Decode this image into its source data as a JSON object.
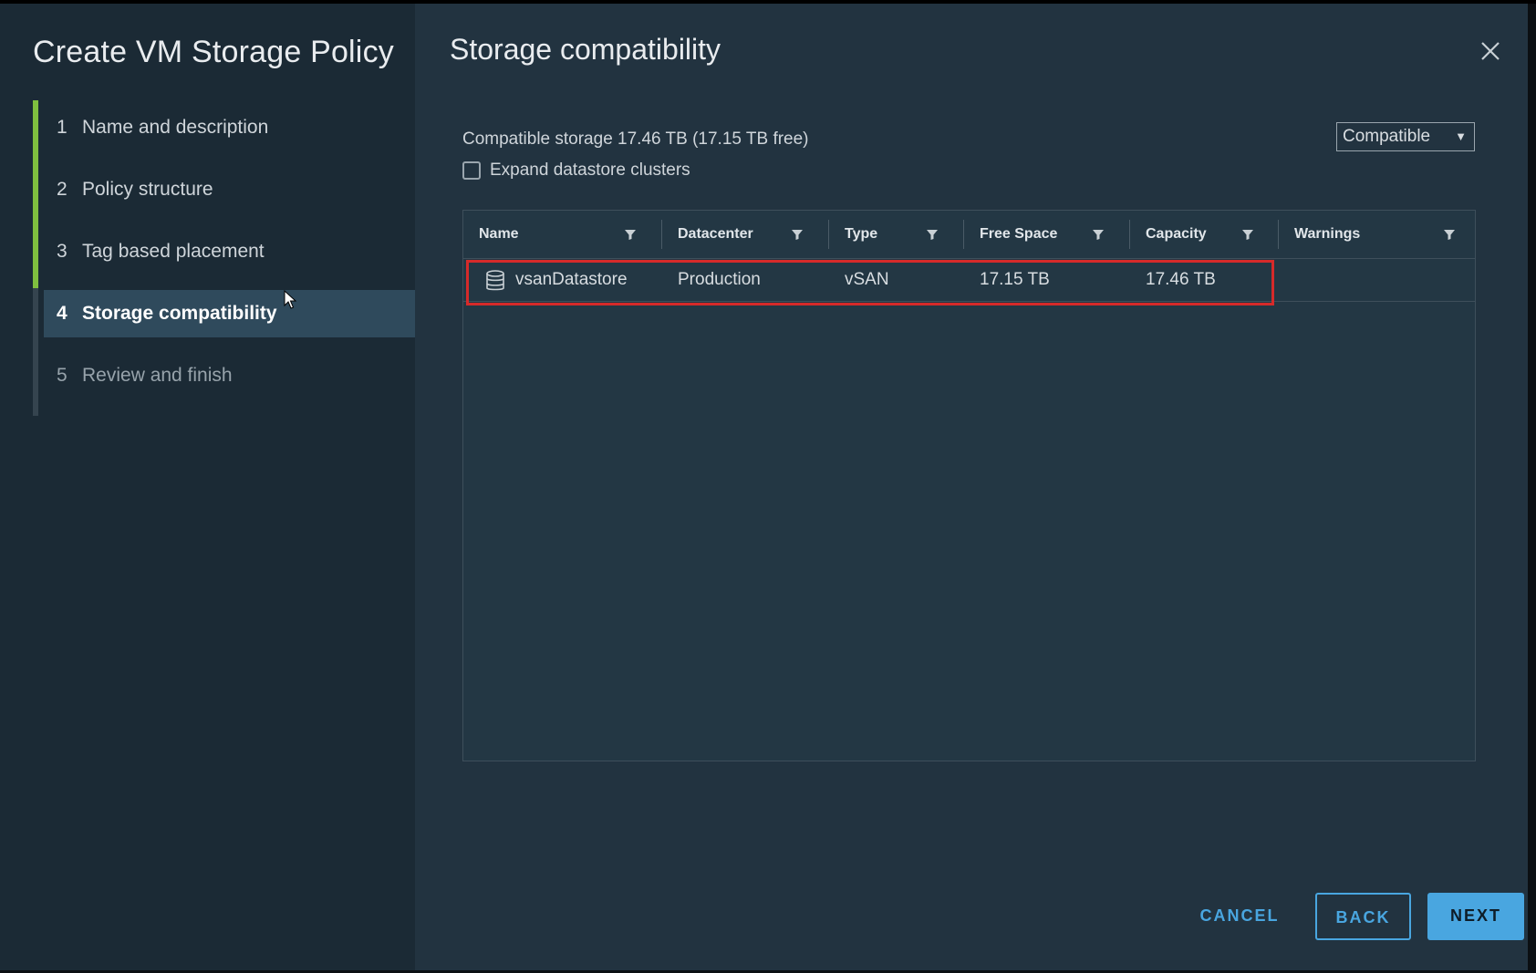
{
  "wizard": {
    "title": "Create VM Storage Policy",
    "steps": [
      {
        "num": "1",
        "label": "Name and description"
      },
      {
        "num": "2",
        "label": "Policy structure"
      },
      {
        "num": "3",
        "label": "Tag based placement"
      },
      {
        "num": "4",
        "label": "Storage compatibility"
      },
      {
        "num": "5",
        "label": "Review and finish"
      }
    ]
  },
  "page": {
    "title": "Storage compatibility",
    "summary": "Compatible storage 17.46 TB (17.15 TB free)",
    "expand_label": "Expand datastore clusters",
    "filter_selected": "Compatible"
  },
  "table": {
    "columns": [
      "Name",
      "Datacenter",
      "Type",
      "Free Space",
      "Capacity",
      "Warnings"
    ],
    "rows": [
      {
        "name": "vsanDatastore",
        "datacenter": "Production",
        "type": "vSAN",
        "free_space": "17.15 TB",
        "capacity": "17.46 TB",
        "warnings": ""
      }
    ]
  },
  "buttons": {
    "cancel": "CANCEL",
    "back": "BACK",
    "next": "NEXT"
  },
  "icons": {
    "close": "close-icon",
    "filter": "funnel-icon",
    "datastore": "database-icon"
  },
  "colors": {
    "accent": "#49a6e0",
    "progress": "#7fbf3f",
    "highlight": "#d62a2a"
  }
}
